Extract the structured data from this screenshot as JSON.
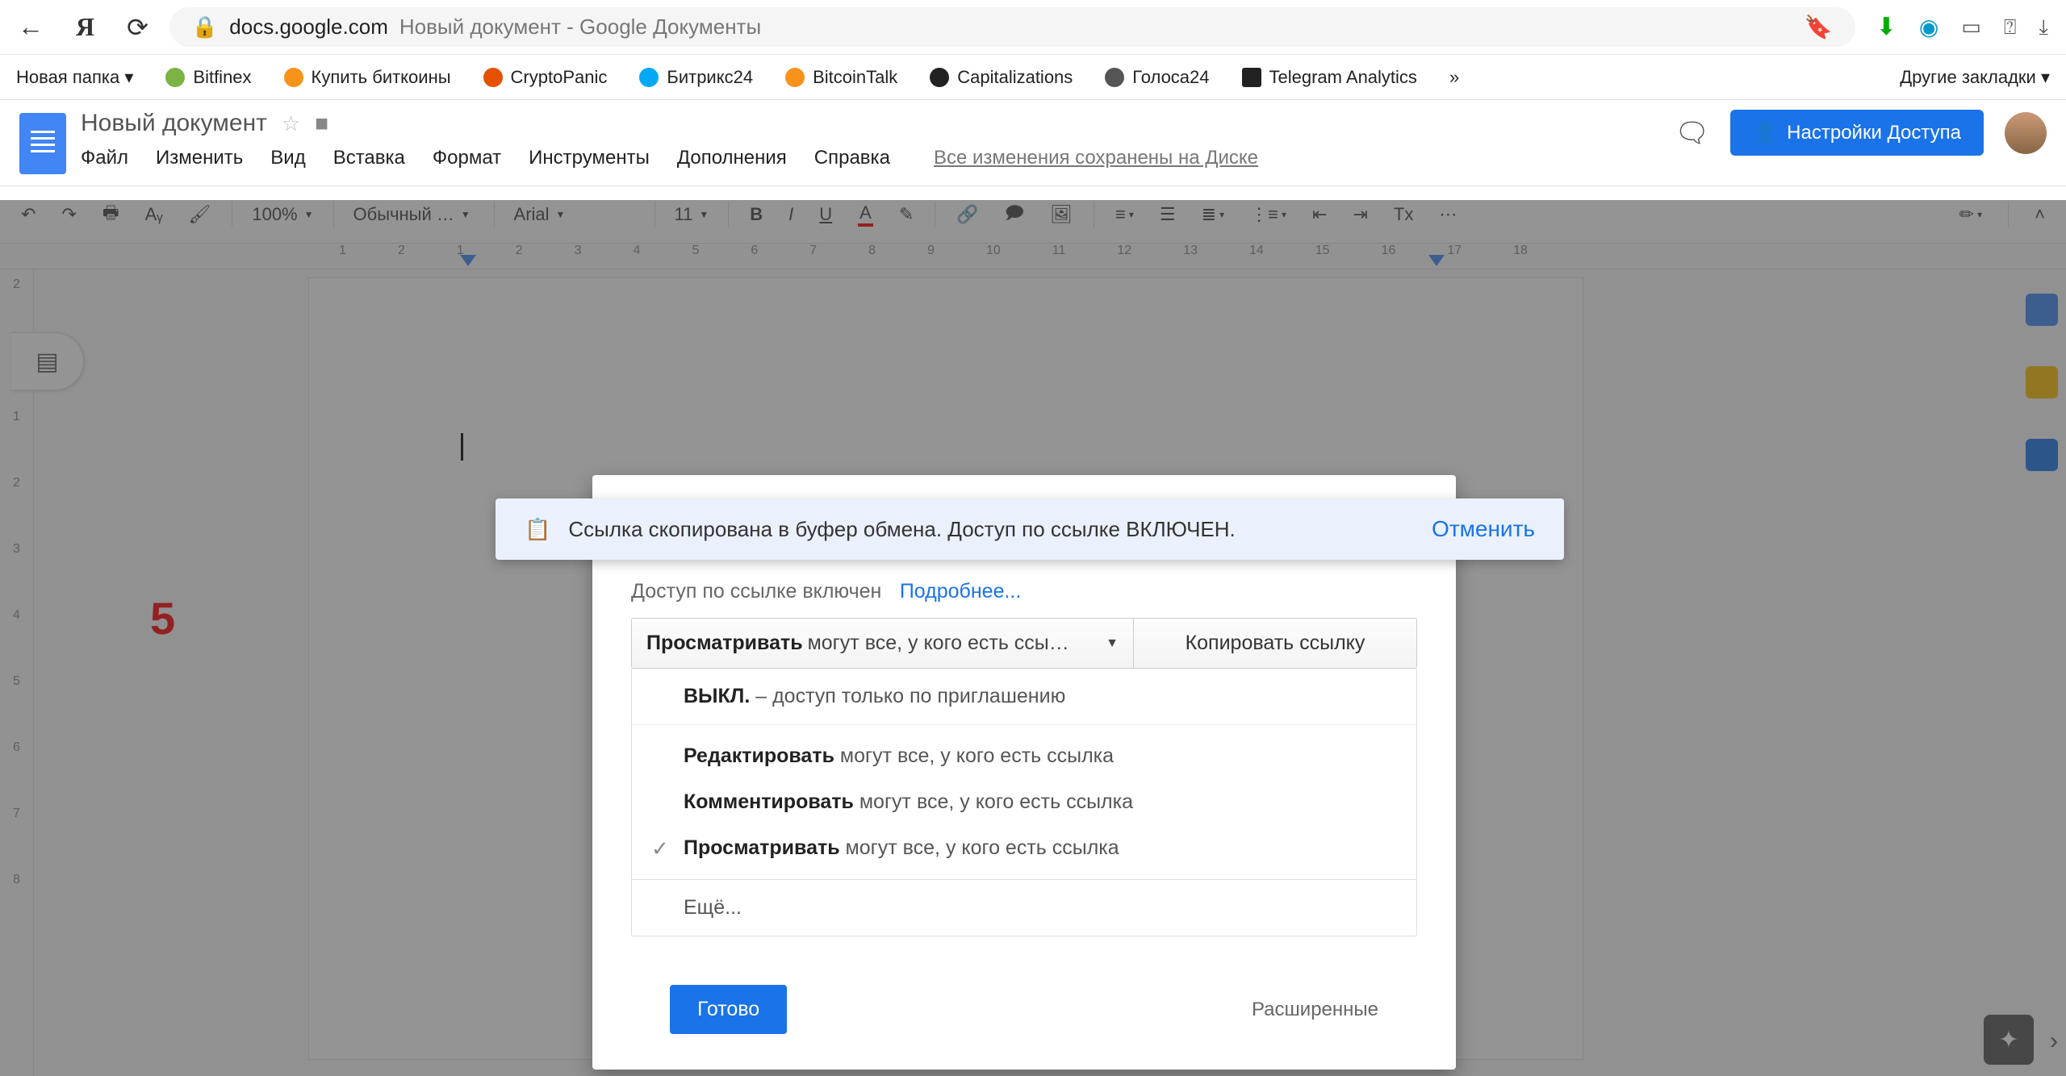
{
  "browser": {
    "host": "docs.google.com",
    "page_title": "Новый документ - Google Документы"
  },
  "bookmarks": {
    "items": [
      {
        "label": "Новая папка ▾"
      },
      {
        "label": "Bitfinex"
      },
      {
        "label": "Купить биткоины"
      },
      {
        "label": "CryptoPanic"
      },
      {
        "label": "Битрикс24"
      },
      {
        "label": "BitcoinTalk"
      },
      {
        "label": "Capitalizations"
      },
      {
        "label": "Голоса24"
      },
      {
        "label": "Telegram Analytics"
      }
    ],
    "overflow": "»",
    "other": "Другие закладки ▾"
  },
  "docs": {
    "title": "Новый документ",
    "menus": [
      "Файл",
      "Изменить",
      "Вид",
      "Вставка",
      "Формат",
      "Инструменты",
      "Дополнения",
      "Справка"
    ],
    "saved": "Все изменения сохранены на Диске",
    "share_label": "Настройки Доступа"
  },
  "toolbar": {
    "zoom": "100%",
    "style": "Обычный …",
    "font": "Arial",
    "size": "11"
  },
  "annotation": {
    "five": "5"
  },
  "toast": {
    "msg": "Ссылка скопирована в буфер обмена. Доступ по ссылке ВКЛЮЧЕН.",
    "undo": "Отменить"
  },
  "dialog": {
    "heading": "Доступ по ссылке включен",
    "learn_more": "Подробнее...",
    "perm_bold": "Просматривать",
    "perm_rest": "могут все, у кого есть ссы…",
    "copy": "Копировать ссылку",
    "options": {
      "off_bold": "ВЫКЛ.",
      "off_rest": " – доступ только по приглашению",
      "edit_bold": "Редактировать",
      "edit_rest": " могут все, у кого есть ссылка",
      "comment_bold": "Комментировать",
      "comment_rest": " могут все, у кого есть ссылка",
      "view_bold": "Просматривать",
      "view_rest": " могут все, у кого есть ссылка",
      "more": "Ещё..."
    },
    "done": "Готово",
    "advanced": "Расширенные"
  }
}
